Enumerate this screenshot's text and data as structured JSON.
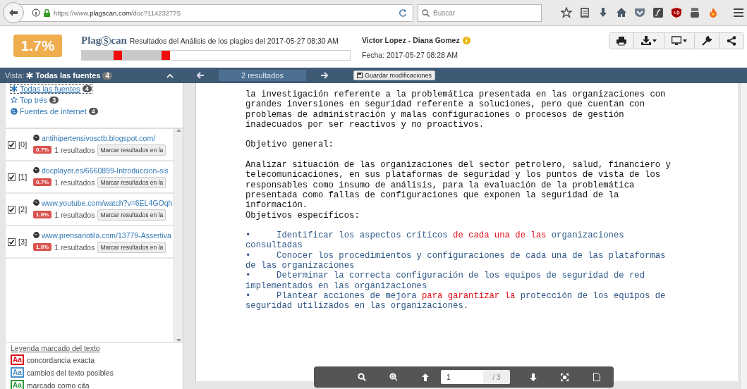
{
  "browser": {
    "url_prefix": "https://www.",
    "url_domain": "plagscan.com",
    "url_path": "/doc?114232775",
    "search_placeholder": "Buscar"
  },
  "header": {
    "score": "1.7%",
    "logo_parts": [
      "Plag",
      "S",
      "can"
    ],
    "title": "Resultados del Análisis de los plagios del 2017-05-27 08:30 AM",
    "author": "Victor Lopez - Diana Gomez",
    "date": "Fecha: 2017-05-27 08:28 AM",
    "bar": {
      "level": 0.327,
      "matches": [
        {
          "level": 0.134
        },
        {
          "level": 0.312
        }
      ]
    },
    "tools": [
      {
        "kind": "print",
        "dropdown": false
      },
      {
        "kind": "download",
        "dropdown": true
      },
      {
        "kind": "display",
        "dropdown": true
      },
      {
        "kind": "wrench",
        "dropdown": false
      },
      {
        "kind": "share",
        "dropdown": false
      }
    ]
  },
  "navbar": {
    "view_label": "Vista:",
    "view_name": "Todas las fuentes",
    "view_count": "4",
    "results": "2 resultados",
    "save": "Guardar modificaciones"
  },
  "filters": [
    {
      "kind": "all",
      "label": "Todas las fuentes",
      "count": "4",
      "selected": true
    },
    {
      "kind": "star",
      "label": "Top trés",
      "count": "3",
      "selected": false
    },
    {
      "kind": "globe",
      "label": "Fuentes de internet",
      "count": "4",
      "selected": false
    }
  ],
  "sources": [
    {
      "index": "[0]",
      "checked": true,
      "url": "antihipertensivosctb.blogspot.com/",
      "percent": "0.7%",
      "results": "1 resultados",
      "button": "Marcar resultados en la"
    },
    {
      "index": "[1]",
      "checked": true,
      "url": "docplayer.es/6660899-Introduccion-sis",
      "percent": "0.7%",
      "results": "1 resultados",
      "button": "Marcar resultados en la"
    },
    {
      "index": "[2]",
      "checked": true,
      "url": "www.youtube.com/watch?v=6EL4GOqh",
      "percent": "1.0%",
      "results": "1 resultados",
      "button": "Marcar resultados en la"
    },
    {
      "index": "[3]",
      "checked": true,
      "url": "www.prensariotila.com/13779-Assertiva",
      "percent": "1.0%",
      "results": "1 resultados",
      "button": "Marcar resultados en la"
    }
  ],
  "legend": {
    "title": "Leyenda marcado del texto",
    "items": [
      {
        "sample": "Aa",
        "label": "concordancia exacta",
        "color": "#d9111a"
      },
      {
        "sample": "Aa",
        "label": "cambios del texto posibles",
        "color": "#4a90c8"
      },
      {
        "sample": "Aa",
        "label": "marcado como cita",
        "color": "#2e9a3a"
      }
    ]
  },
  "document": {
    "blocks": [
      {
        "lines": [
          [
            {
              "kind": "plain",
              "text": "la investigación referente a la problemática presentada en las organizaciones con"
            }
          ],
          [
            {
              "kind": "plain",
              "text": "grandes inversiones en seguridad referente a soluciones, pero que cuentan con"
            }
          ],
          [
            {
              "kind": "plain",
              "text": "problemas de administración y malas configuraciones o procesos de gestión"
            }
          ],
          [
            {
              "kind": "plain",
              "text": "inadecuados por ser reactivos y no proactivos."
            }
          ]
        ]
      },
      {
        "lines": [
          [
            {
              "kind": "plain",
              "text": "Objetivo general:"
            }
          ]
        ]
      },
      {
        "lines": [
          [
            {
              "kind": "plain",
              "text": "Analizar situación de las organizaciones del sector petrolero, salud, financiero y"
            }
          ],
          [
            {
              "kind": "plain",
              "text": "telecomunicaciones, en sus plataformas de seguridad y los puntos de vista de los"
            }
          ],
          [
            {
              "kind": "plain",
              "text": "responsables como insumo de análisis, para la evaluación de la problemática"
            }
          ],
          [
            {
              "kind": "plain",
              "text": "presentada como fallas de configuraciones que exponen la seguridad de la"
            }
          ],
          [
            {
              "kind": "plain",
              "text": "información."
            }
          ],
          [
            {
              "kind": "plain",
              "text": "Objetivos específicos:"
            }
          ]
        ]
      },
      {
        "lines": [
          [
            {
              "kind": "changed",
              "text": "•     Identificar los aspectos críticos "
            },
            {
              "kind": "exact",
              "text": "de cada una de las"
            },
            {
              "kind": "changed",
              "text": " organizaciones"
            }
          ],
          [
            {
              "kind": "changed",
              "text": "consultadas"
            }
          ],
          [
            {
              "kind": "changed",
              "text": "•     Conocer los procedimientos y configuraciones de cada una de las plataformas"
            }
          ],
          [
            {
              "kind": "changed",
              "text": "de las organizaciones"
            }
          ],
          [
            {
              "kind": "changed",
              "text": "•     Determinar la correcta configuración de los equipos de seguridad de red"
            }
          ],
          [
            {
              "kind": "changed",
              "text": "implementados en las organizaciones"
            }
          ],
          [
            {
              "kind": "changed",
              "text": "•     Plantear acciones de mejora "
            },
            {
              "kind": "exact",
              "text": "para garantizar la"
            },
            {
              "kind": "changed",
              "text": " protección de los equipos de"
            }
          ],
          [
            {
              "kind": "changed",
              "text": "seguridad utilizados en las organizaciones."
            }
          ]
        ]
      }
    ]
  },
  "pager": {
    "page": "1",
    "total": "/ 3"
  }
}
